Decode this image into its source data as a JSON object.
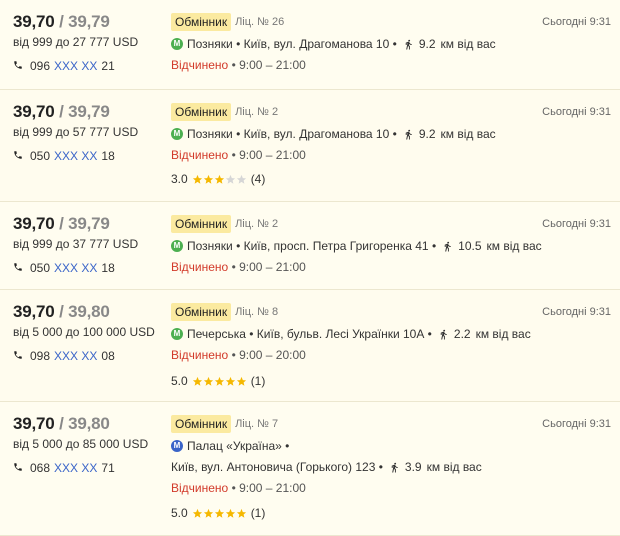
{
  "accent": {
    "metro_green": "#4caf50",
    "metro_blue": "#3a64c8",
    "open_red": "#d23a2a",
    "badge_bg": "#fbeaa0",
    "star_full": "#f5b800",
    "star_empty": "#d6d6d6"
  },
  "offers": [
    {
      "buy": "39,70",
      "sep": "/",
      "sell": "39,79",
      "range": "від 999 до 27 777 USD",
      "phone_prefix": "096",
      "phone_mask": "XXX XX",
      "phone_suffix": "21",
      "badge": "Обмінник",
      "license": "Ліц. № 26",
      "time": "Сьогодні 9:31",
      "metro_icon": "metro-green-icon",
      "metro_letter": "М",
      "metro_color": "#4caf50",
      "address_line1": "Позняки • Київ, вул. Драгоманова 10 •",
      "address_line2": "",
      "distance_num": "9.2",
      "distance_unit": "км від вас",
      "status": "Відчинено",
      "hours": "• 9:00 – 21:00",
      "rating": null
    },
    {
      "buy": "39,70",
      "sep": "/",
      "sell": "39,79",
      "range": "від 999 до 57 777 USD",
      "phone_prefix": "050",
      "phone_mask": "XXX XX",
      "phone_suffix": "18",
      "badge": "Обмінник",
      "license": "Ліц. № 2",
      "time": "Сьогодні 9:31",
      "metro_icon": "metro-green-icon",
      "metro_letter": "М",
      "metro_color": "#4caf50",
      "address_line1": "Позняки • Київ, вул. Драгоманова 10 •",
      "address_line2": "",
      "distance_num": "9.2",
      "distance_unit": "км від вас",
      "status": "Відчинено",
      "hours": "• 9:00 – 21:00",
      "rating": {
        "score": "3.0",
        "stars": 3,
        "count": "(4)"
      }
    },
    {
      "buy": "39,70",
      "sep": "/",
      "sell": "39,79",
      "range": "від 999 до 37 777 USD",
      "phone_prefix": "050",
      "phone_mask": "XXX XX",
      "phone_suffix": "18",
      "badge": "Обмінник",
      "license": "Ліц. № 2",
      "time": "Сьогодні 9:31",
      "metro_icon": "metro-green-icon",
      "metro_letter": "М",
      "metro_color": "#4caf50",
      "address_line1": "Позняки • Київ, просп. Петра Григоренка 41 •",
      "address_line2": "",
      "distance_num": "10.5",
      "distance_unit": "км від вас",
      "status": "Відчинено",
      "hours": "• 9:00 – 21:00",
      "rating": null
    },
    {
      "buy": "39,70",
      "sep": "/",
      "sell": "39,80",
      "range": "від 5 000 до 100 000 USD",
      "phone_prefix": "098",
      "phone_mask": "XXX XX",
      "phone_suffix": "08",
      "badge": "Обмінник",
      "license": "Ліц. № 8",
      "time": "Сьогодні 9:31",
      "metro_icon": "metro-green-icon",
      "metro_letter": "М",
      "metro_color": "#4caf50",
      "address_line1": "Печерська • Київ, бульв. Лесі Українки 10А •",
      "address_line2": "",
      "distance_num": "2.2",
      "distance_unit": "км від вас",
      "status": "Відчинено",
      "hours": "• 9:00 – 20:00",
      "rating": {
        "score": "5.0",
        "stars": 5,
        "count": "(1)"
      }
    },
    {
      "buy": "39,70",
      "sep": "/",
      "sell": "39,80",
      "range": "від 5 000 до 85 000 USD",
      "phone_prefix": "068",
      "phone_mask": "XXX XX",
      "phone_suffix": "71",
      "badge": "Обмінник",
      "license": "Ліц. № 7",
      "time": "Сьогодні 9:31",
      "metro_icon": "metro-blue-icon",
      "metro_letter": "М",
      "metro_color": "#3a64c8",
      "address_line1": "Палац «Україна» •",
      "address_line2": "Київ, вул. Антоновича (Горького) 123 •",
      "distance_num": "3.9",
      "distance_unit": "км від вас",
      "status": "Відчинено",
      "hours": "• 9:00 – 21:00",
      "rating": {
        "score": "5.0",
        "stars": 5,
        "count": "(1)"
      }
    }
  ]
}
